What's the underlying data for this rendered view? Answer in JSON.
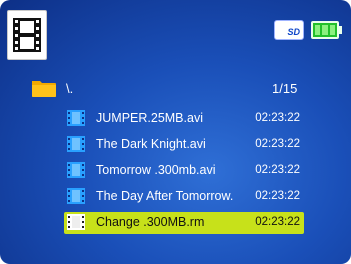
{
  "header": {
    "category_icon": "film-icon",
    "storage_icon": "sd-card-icon",
    "storage_label": "SD",
    "battery_icon": "battery-full-icon"
  },
  "path": {
    "folder_icon": "folder-icon",
    "text": "\\.",
    "page": "1/15"
  },
  "files": [
    {
      "name": "JUMPER.25MB.avi",
      "duration": "02:23:22",
      "icon": "video-file-icon",
      "selected": false
    },
    {
      "name": "The Dark Knight.avi",
      "duration": "02:23:22",
      "icon": "video-file-icon",
      "selected": false
    },
    {
      "name": "Tomorrow .300mb.avi",
      "duration": "02:23:22",
      "icon": "video-file-icon",
      "selected": false
    },
    {
      "name": "The Day After Tomorrow.",
      "duration": "02:23:22",
      "icon": "video-file-icon",
      "selected": false
    },
    {
      "name": "Change .300MB.rm",
      "duration": "02:23:22",
      "icon": "video-file-icon",
      "selected": true
    }
  ],
  "colors": {
    "background": "#1a4fb8",
    "selection": "#c7e11a",
    "battery": "#22c02a",
    "icon_blue": "#29a0ff"
  }
}
